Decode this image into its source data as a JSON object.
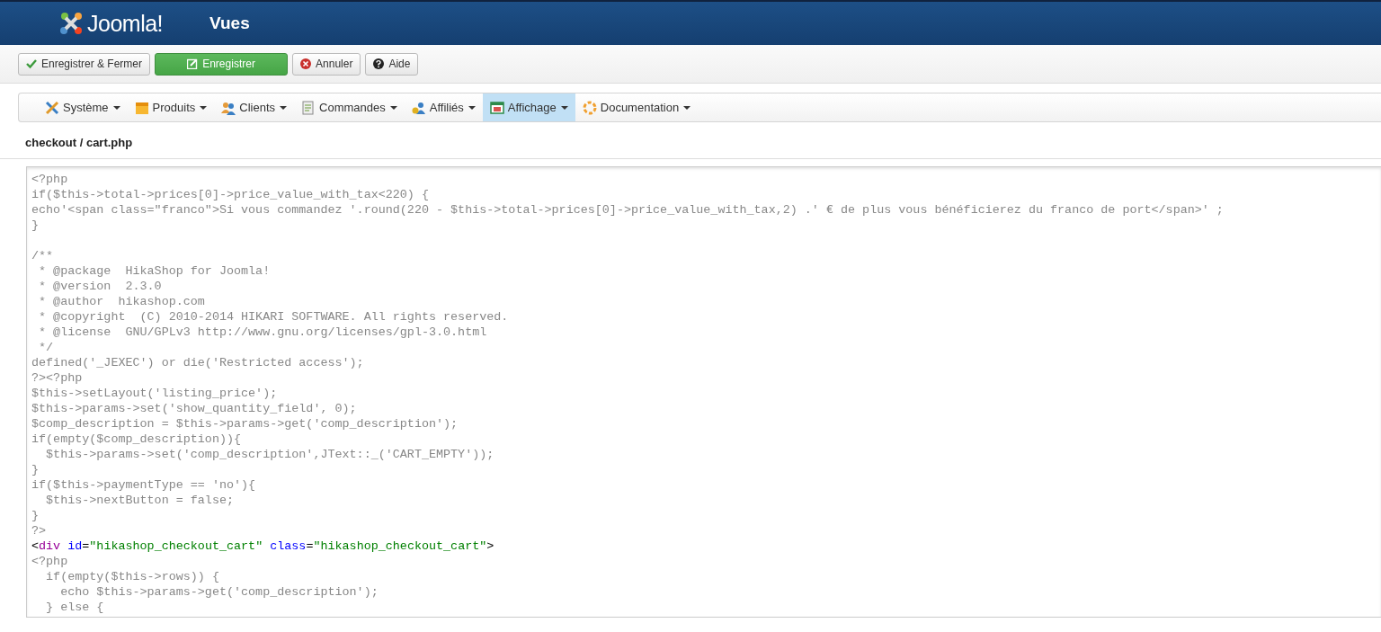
{
  "header": {
    "logo_text": "Joomla!",
    "title": "Vues"
  },
  "toolbar": [
    {
      "label": "Enregistrer & Fermer",
      "kind": "save-close"
    },
    {
      "label": "Enregistrer",
      "kind": "save"
    },
    {
      "label": "Annuler",
      "kind": "cancel"
    },
    {
      "label": "Aide",
      "kind": "help"
    }
  ],
  "menu": [
    {
      "label": "Système",
      "selected": false
    },
    {
      "label": "Produits",
      "selected": false
    },
    {
      "label": "Clients",
      "selected": false
    },
    {
      "label": "Commandes",
      "selected": false
    },
    {
      "label": "Affiliés",
      "selected": false
    },
    {
      "label": "Affichage",
      "selected": true
    },
    {
      "label": "Documentation",
      "selected": false
    }
  ],
  "file_title": "checkout / cart.php",
  "code": [
    {
      "kind": "plain",
      "text": "<?php"
    },
    {
      "kind": "plain",
      "text": "if($this->total->prices[0]->price_value_with_tax<220) {"
    },
    {
      "kind": "plain",
      "text": "echo'<span class=\"franco\">Si vous commandez '.round(220 - $this->total->prices[0]->price_value_with_tax,2) .' € de plus vous bénéficierez du franco de port</span>' ;"
    },
    {
      "kind": "plain",
      "text": "}"
    },
    {
      "kind": "blank"
    },
    {
      "kind": "plain",
      "text": "/**"
    },
    {
      "kind": "plain",
      "text": " * @package  HikaShop for Joomla!"
    },
    {
      "kind": "plain",
      "text": " * @version  2.3.0"
    },
    {
      "kind": "plain",
      "text": " * @author  hikashop.com"
    },
    {
      "kind": "plain",
      "text": " * @copyright  (C) 2010-2014 HIKARI SOFTWARE. All rights reserved."
    },
    {
      "kind": "plain",
      "text": " * @license  GNU/GPLv3 http://www.gnu.org/licenses/gpl-3.0.html"
    },
    {
      "kind": "plain",
      "text": " */"
    },
    {
      "kind": "plain",
      "text": "defined('_JEXEC') or die('Restricted access');"
    },
    {
      "kind": "plain",
      "text": "?><?php"
    },
    {
      "kind": "plain",
      "text": "$this->setLayout('listing_price');"
    },
    {
      "kind": "plain",
      "text": "$this->params->set('show_quantity_field', 0);"
    },
    {
      "kind": "plain",
      "text": "$comp_description = $this->params->get('comp_description');"
    },
    {
      "kind": "plain",
      "text": "if(empty($comp_description)){"
    },
    {
      "kind": "plain",
      "text": "  $this->params->set('comp_description',JText::_('CART_EMPTY'));"
    },
    {
      "kind": "plain",
      "text": "}"
    },
    {
      "kind": "plain",
      "text": "if($this->paymentType == 'no'){"
    },
    {
      "kind": "plain",
      "text": "  $this->nextButton = false;"
    },
    {
      "kind": "plain",
      "text": "}"
    },
    {
      "kind": "plain",
      "text": "?>"
    },
    {
      "kind": "markup",
      "tokens": [
        {
          "kind": "punct",
          "text": "<"
        },
        {
          "kind": "tag",
          "text": "div"
        },
        {
          "kind": "attr",
          "text": " id"
        },
        {
          "kind": "punct",
          "text": "="
        },
        {
          "kind": "string",
          "text": "\"hikashop_checkout_cart\""
        },
        {
          "kind": "attr",
          "text": " class"
        },
        {
          "kind": "punct",
          "text": "="
        },
        {
          "kind": "string",
          "text": "\"hikashop_checkout_cart\""
        },
        {
          "kind": "punct",
          "text": ">"
        }
      ]
    },
    {
      "kind": "plain",
      "text": "<?php"
    },
    {
      "kind": "plain",
      "text": "  if(empty($this->rows)) {"
    },
    {
      "kind": "plain",
      "text": "    echo $this->params->get('comp_description');"
    },
    {
      "kind": "plain",
      "text": "  } else {"
    }
  ]
}
